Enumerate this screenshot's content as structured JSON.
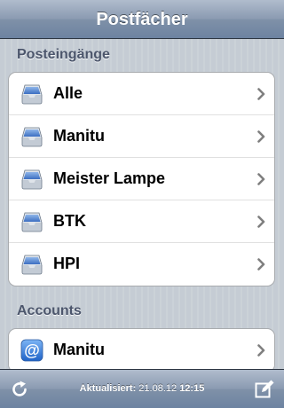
{
  "navbar": {
    "title": "Postfächer"
  },
  "sections": [
    {
      "header": "Posteingänge",
      "items": [
        {
          "label": "Alle",
          "icon": "inbox-icon"
        },
        {
          "label": "Manitu",
          "icon": "inbox-icon"
        },
        {
          "label": "Meister Lampe",
          "icon": "inbox-icon"
        },
        {
          "label": "BTK",
          "icon": "inbox-icon"
        },
        {
          "label": "HPI",
          "icon": "inbox-icon"
        }
      ]
    },
    {
      "header": "Accounts",
      "items": [
        {
          "label": "Manitu",
          "icon": "at-sign-icon"
        }
      ]
    }
  ],
  "toolbar": {
    "refresh_icon": "refresh-icon",
    "compose_icon": "compose-icon",
    "updated_label": "Aktualisiert:",
    "updated_date": "21.08.12",
    "updated_time": "12:15"
  },
  "colors": {
    "bar_blue": "#6d83a1",
    "background": "#c5ccd4",
    "section_header": "#4c566c",
    "inbox_icon_blue": "#5a8fd6",
    "account_icon_blue": "#2f7fe0"
  }
}
